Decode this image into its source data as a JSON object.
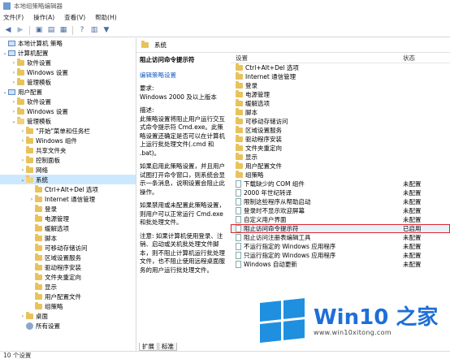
{
  "window": {
    "title": "本地组策略编辑器"
  },
  "menu": [
    "文件(F)",
    "操作(A)",
    "查看(V)",
    "帮助(H)"
  ],
  "tree": {
    "items": [
      {
        "label": "本地计算机 策略",
        "depth": 0,
        "tw": "",
        "icon": "pc"
      },
      {
        "label": "计算机配置",
        "depth": 0,
        "tw": "⌄",
        "icon": "pc"
      },
      {
        "label": "软件设置",
        "depth": 1,
        "tw": "›",
        "icon": "folder"
      },
      {
        "label": "Windows 设置",
        "depth": 1,
        "tw": "›",
        "icon": "folder"
      },
      {
        "label": "管理模板",
        "depth": 1,
        "tw": "›",
        "icon": "folder"
      },
      {
        "label": "用户配置",
        "depth": 0,
        "tw": "⌄",
        "icon": "pc"
      },
      {
        "label": "软件设置",
        "depth": 1,
        "tw": "›",
        "icon": "folder"
      },
      {
        "label": "Windows 设置",
        "depth": 1,
        "tw": "›",
        "icon": "folder"
      },
      {
        "label": "管理模板",
        "depth": 1,
        "tw": "⌄",
        "icon": "folder"
      },
      {
        "label": "\"开始\"菜单和任务栏",
        "depth": 2,
        "tw": "›",
        "icon": "folder"
      },
      {
        "label": "Windows 组件",
        "depth": 2,
        "tw": "›",
        "icon": "folder"
      },
      {
        "label": "共享文件夹",
        "depth": 2,
        "tw": "",
        "icon": "folder"
      },
      {
        "label": "控制面板",
        "depth": 2,
        "tw": "›",
        "icon": "folder"
      },
      {
        "label": "网络",
        "depth": 2,
        "tw": "›",
        "icon": "folder"
      },
      {
        "label": "系统",
        "depth": 2,
        "tw": "⌄",
        "icon": "folder",
        "sel": true
      },
      {
        "label": "Ctrl+Alt+Del 选项",
        "depth": 3,
        "tw": "",
        "icon": "folder"
      },
      {
        "label": "Internet 通信管理",
        "depth": 3,
        "tw": "›",
        "icon": "folder"
      },
      {
        "label": "登录",
        "depth": 3,
        "tw": "",
        "icon": "folder"
      },
      {
        "label": "电源管理",
        "depth": 3,
        "tw": "",
        "icon": "folder"
      },
      {
        "label": "缓解选项",
        "depth": 3,
        "tw": "",
        "icon": "folder"
      },
      {
        "label": "脚本",
        "depth": 3,
        "tw": "",
        "icon": "folder"
      },
      {
        "label": "可移动存储访问",
        "depth": 3,
        "tw": "",
        "icon": "folder"
      },
      {
        "label": "区域设置服务",
        "depth": 3,
        "tw": "",
        "icon": "folder"
      },
      {
        "label": "驱动程序安装",
        "depth": 3,
        "tw": "",
        "icon": "folder"
      },
      {
        "label": "文件夹重定向",
        "depth": 3,
        "tw": "",
        "icon": "folder"
      },
      {
        "label": "显示",
        "depth": 3,
        "tw": "",
        "icon": "folder"
      },
      {
        "label": "用户配置文件",
        "depth": 3,
        "tw": "",
        "icon": "folder"
      },
      {
        "label": "组策略",
        "depth": 3,
        "tw": "",
        "icon": "folder"
      },
      {
        "label": "桌面",
        "depth": 2,
        "tw": "›",
        "icon": "folder"
      },
      {
        "label": "所有设置",
        "depth": 2,
        "tw": "",
        "icon": "gear"
      }
    ]
  },
  "panel": {
    "folder": "系统"
  },
  "description": {
    "title": "阻止访问命令提示符",
    "edit_link": "编辑策略设置",
    "req_label": "要求:",
    "req_text": "Windows 2000 及以上版本",
    "desc_label": "描述:",
    "p1": "此策略设置将阻止用户运行交互式命令提示符 Cmd.exe。此策略设置还确定是否可以在计算机上运行批处理文件(.cmd 和 .bat)。",
    "p2": "如果启用此策略设置，并且用户试图打开命令窗口，则系统会显示一条消息，说明设置会阻止此操作。",
    "p3": "如果禁用或未配置此策略设置，则用户可以正常运行 Cmd.exe 和批处理文件。",
    "p4": "注意: 如果计算机使用登录、注销、启动或关机批处理文件脚本，则不阻止计算机运行批处理文件，也不阻止使用远程桌面服务的用户运行批处理文件。"
  },
  "list": {
    "header": {
      "setting": "设置",
      "state": "状态"
    },
    "rows": [
      {
        "name": "Ctrl+Alt+Del 选项",
        "state": "",
        "type": "folder"
      },
      {
        "name": "Internet 通信管理",
        "state": "",
        "type": "folder"
      },
      {
        "name": "登录",
        "state": "",
        "type": "folder"
      },
      {
        "name": "电源管理",
        "state": "",
        "type": "folder"
      },
      {
        "name": "缓解选项",
        "state": "",
        "type": "folder"
      },
      {
        "name": "脚本",
        "state": "",
        "type": "folder"
      },
      {
        "name": "可移动存储访问",
        "state": "",
        "type": "folder"
      },
      {
        "name": "区域设置服务",
        "state": "",
        "type": "folder"
      },
      {
        "name": "驱动程序安装",
        "state": "",
        "type": "folder"
      },
      {
        "name": "文件夹重定向",
        "state": "",
        "type": "folder"
      },
      {
        "name": "显示",
        "state": "",
        "type": "folder"
      },
      {
        "name": "用户配置文件",
        "state": "",
        "type": "folder"
      },
      {
        "name": "组策略",
        "state": "",
        "type": "folder"
      },
      {
        "name": "下载缺少的 COM 组件",
        "state": "未配置",
        "type": "setting"
      },
      {
        "name": "2000 年世纪转译",
        "state": "未配置",
        "type": "setting"
      },
      {
        "name": "限制这些程序从帮助启动",
        "state": "未配置",
        "type": "setting"
      },
      {
        "name": "登录时不显示欢迎屏幕",
        "state": "未配置",
        "type": "setting"
      },
      {
        "name": "自定义用户界面",
        "state": "未配置",
        "type": "setting"
      },
      {
        "name": "阻止访问命令提示符",
        "state": "已启用",
        "type": "setting",
        "highlight": true
      },
      {
        "name": "阻止访问注册表编辑工具",
        "state": "未配置",
        "type": "setting"
      },
      {
        "name": "不运行指定的 Windows 应用程序",
        "state": "未配置",
        "type": "setting"
      },
      {
        "name": "只运行指定的 Windows 应用程序",
        "state": "未配置",
        "type": "setting"
      },
      {
        "name": "Windows 自动更新",
        "state": "未配置",
        "type": "setting"
      }
    ]
  },
  "tabs": [
    "扩展",
    "标准"
  ],
  "status": "10 个设置",
  "watermark": {
    "title": "Win10 之家",
    "url": "www.win10xitong.com"
  },
  "colors": {
    "accent": "#1f8fe0",
    "highlight_border": "#e0262b",
    "folder": "#e8c25c"
  }
}
